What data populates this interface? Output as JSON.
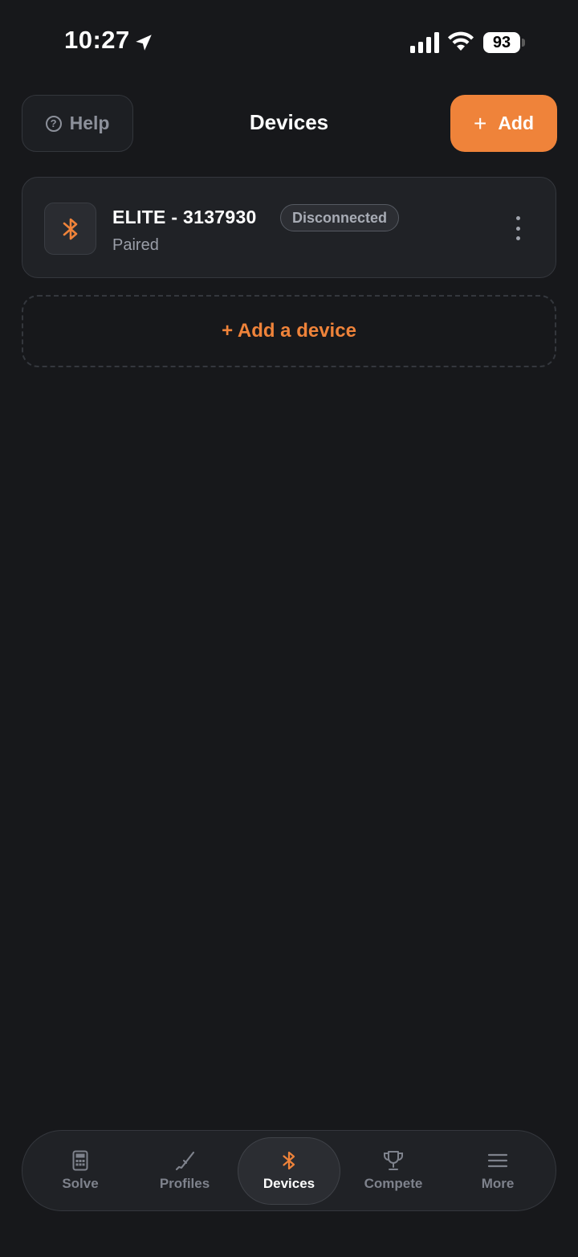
{
  "status_bar": {
    "time": "10:27",
    "battery": "93"
  },
  "header": {
    "help_label": "Help",
    "title": "Devices",
    "add_label": "Add"
  },
  "devices": [
    {
      "name": "ELITE - 3137930",
      "status": "Disconnected",
      "subtitle": "Paired",
      "icon": "bluetooth-icon"
    }
  ],
  "add_device_label": "+ Add a device",
  "tabs": [
    {
      "label": "Solve",
      "icon": "calculator-icon"
    },
    {
      "label": "Profiles",
      "icon": "rifle-icon"
    },
    {
      "label": "Devices",
      "icon": "bluetooth-icon",
      "active": true
    },
    {
      "label": "Compete",
      "icon": "trophy-icon"
    },
    {
      "label": "More",
      "icon": "menu-icon"
    }
  ],
  "colors": {
    "accent": "#ef833a",
    "background": "#17181b",
    "card": "#202226"
  }
}
